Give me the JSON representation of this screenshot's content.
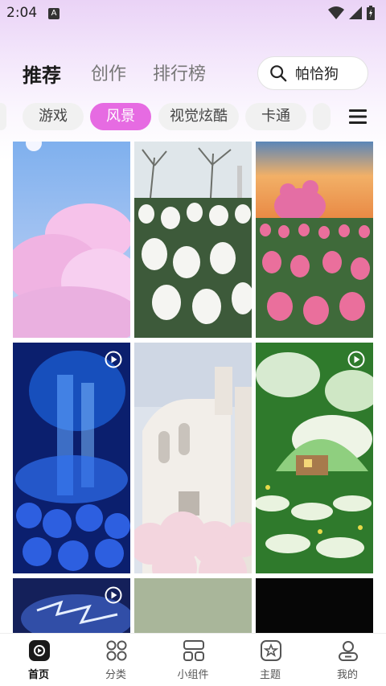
{
  "status": {
    "time": "2:04",
    "indicator": "A"
  },
  "header": {
    "tabs": [
      {
        "label": "推荐",
        "active": true
      },
      {
        "label": "创作",
        "active": false
      },
      {
        "label": "排行榜",
        "active": false
      }
    ],
    "search": {
      "text": "帕恰狗",
      "icon": "search-icon"
    }
  },
  "categories": {
    "items": [
      {
        "label": "游戏",
        "active": false
      },
      {
        "label": "风景",
        "active": true
      },
      {
        "label": "视觉炫酷",
        "active": false
      },
      {
        "label": "卡通",
        "active": false
      }
    ],
    "menu_icon": "menu-icon",
    "accent": "#e66be2"
  },
  "wallpapers": [
    {
      "subject": "pink clouds",
      "video": false
    },
    {
      "subject": "white tulips",
      "video": false
    },
    {
      "subject": "pink tulips",
      "video": false
    },
    {
      "subject": "blue waterfall",
      "video": true
    },
    {
      "subject": "white building",
      "video": false
    },
    {
      "subject": "green forest",
      "video": true
    },
    {
      "subject": "blue lightning",
      "video": true
    },
    {
      "subject": "sage texture",
      "video": false
    },
    {
      "subject": "black",
      "video": false
    }
  ],
  "bottom_nav": [
    {
      "label": "首页",
      "icon": "home-icon",
      "active": true
    },
    {
      "label": "分类",
      "icon": "category-icon",
      "active": false
    },
    {
      "label": "小组件",
      "icon": "widget-icon",
      "active": false
    },
    {
      "label": "主题",
      "icon": "theme-icon",
      "active": false
    },
    {
      "label": "我的",
      "icon": "profile-icon",
      "active": false
    }
  ]
}
